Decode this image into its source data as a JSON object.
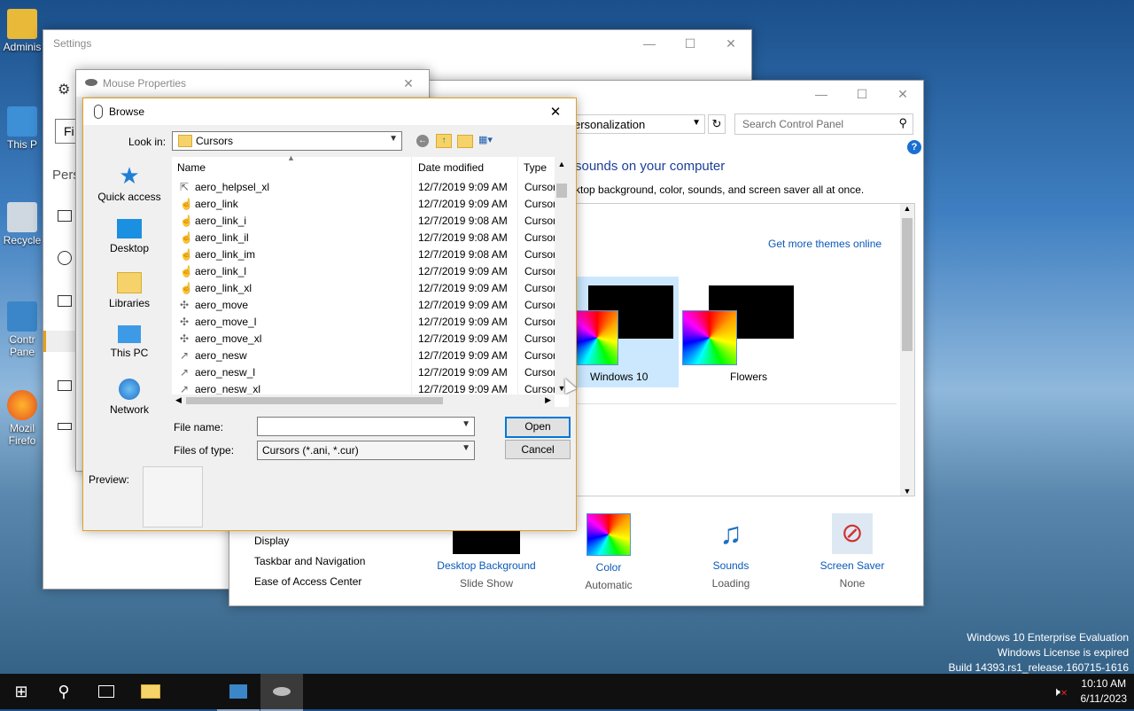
{
  "desktop": {
    "icons": [
      {
        "label": "Adminis",
        "icon": "user-folder-icon"
      },
      {
        "label": "This P",
        "icon": "computer-icon"
      },
      {
        "label": "Recycle",
        "icon": "recycle-bin-icon"
      },
      {
        "label": "Contr Pane",
        "icon": "control-panel-icon"
      },
      {
        "label": "Mozil Firefo",
        "icon": "firefox-icon"
      }
    ],
    "watermark": {
      "line1": "Windows 10 Enterprise Evaluation",
      "line2": "Windows License is expired",
      "line3": "Build 14393.rs1_release.160715-1616"
    }
  },
  "settings_window": {
    "title": "Settings",
    "search_placeholder_partial": "Fi",
    "section_partial": "Pers"
  },
  "control_panel": {
    "address_partial": "ersonalization",
    "search_placeholder": "Search Control Panel",
    "heading_partial": "sounds on your computer",
    "subheading_partial": "ktop background, color, sounds, and screen saver all at once.",
    "get_themes_link": "Get more themes online",
    "themes": [
      {
        "name": "Windows 10",
        "selected": true
      },
      {
        "name": "Flowers",
        "selected": false
      }
    ],
    "see_also": [
      "Display",
      "Taskbar and Navigation",
      "Ease of Access Center"
    ],
    "bottom_items": [
      {
        "label": "Desktop Background",
        "value": "Slide Show",
        "icon": "desktop-background-icon"
      },
      {
        "label": "Color",
        "value": "Automatic",
        "icon": "color-icon"
      },
      {
        "label": "Sounds",
        "value": "Loading",
        "icon": "sounds-icon"
      },
      {
        "label": "Screen Saver",
        "value": "None",
        "icon": "screen-saver-icon"
      }
    ]
  },
  "mouse_properties": {
    "title": "Mouse Properties"
  },
  "browse_dialog": {
    "title": "Browse",
    "look_in_label": "Look in:",
    "look_in_value": "Cursors",
    "places": [
      "Quick access",
      "Desktop",
      "Libraries",
      "This PC",
      "Network"
    ],
    "columns": {
      "name": "Name",
      "date": "Date modified",
      "type": "Type"
    },
    "files": [
      {
        "name": "aero_helpsel_xl",
        "date": "12/7/2019 9:09 AM",
        "type": "Cursor"
      },
      {
        "name": "aero_link",
        "date": "12/7/2019 9:09 AM",
        "type": "Cursor"
      },
      {
        "name": "aero_link_i",
        "date": "12/7/2019 9:08 AM",
        "type": "Cursor"
      },
      {
        "name": "aero_link_il",
        "date": "12/7/2019 9:08 AM",
        "type": "Cursor"
      },
      {
        "name": "aero_link_im",
        "date": "12/7/2019 9:08 AM",
        "type": "Cursor"
      },
      {
        "name": "aero_link_l",
        "date": "12/7/2019 9:09 AM",
        "type": "Cursor"
      },
      {
        "name": "aero_link_xl",
        "date": "12/7/2019 9:09 AM",
        "type": "Cursor"
      },
      {
        "name": "aero_move",
        "date": "12/7/2019 9:09 AM",
        "type": "Cursor"
      },
      {
        "name": "aero_move_l",
        "date": "12/7/2019 9:09 AM",
        "type": "Cursor"
      },
      {
        "name": "aero_move_xl",
        "date": "12/7/2019 9:09 AM",
        "type": "Cursor"
      },
      {
        "name": "aero_nesw",
        "date": "12/7/2019 9:09 AM",
        "type": "Cursor"
      },
      {
        "name": "aero_nesw_l",
        "date": "12/7/2019 9:09 AM",
        "type": "Cursor"
      },
      {
        "name": "aero_nesw_xl",
        "date": "12/7/2019 9:09 AM",
        "type": "Cursor"
      }
    ],
    "file_name_label": "File name:",
    "file_name_value": "",
    "files_of_type_label": "Files of type:",
    "files_of_type_value": "Cursors (*.ani, *.cur)",
    "open_label": "Open",
    "cancel_label": "Cancel",
    "preview_label": "Preview:"
  },
  "taskbar": {
    "time": "10:10 AM",
    "date": "6/11/2023"
  }
}
